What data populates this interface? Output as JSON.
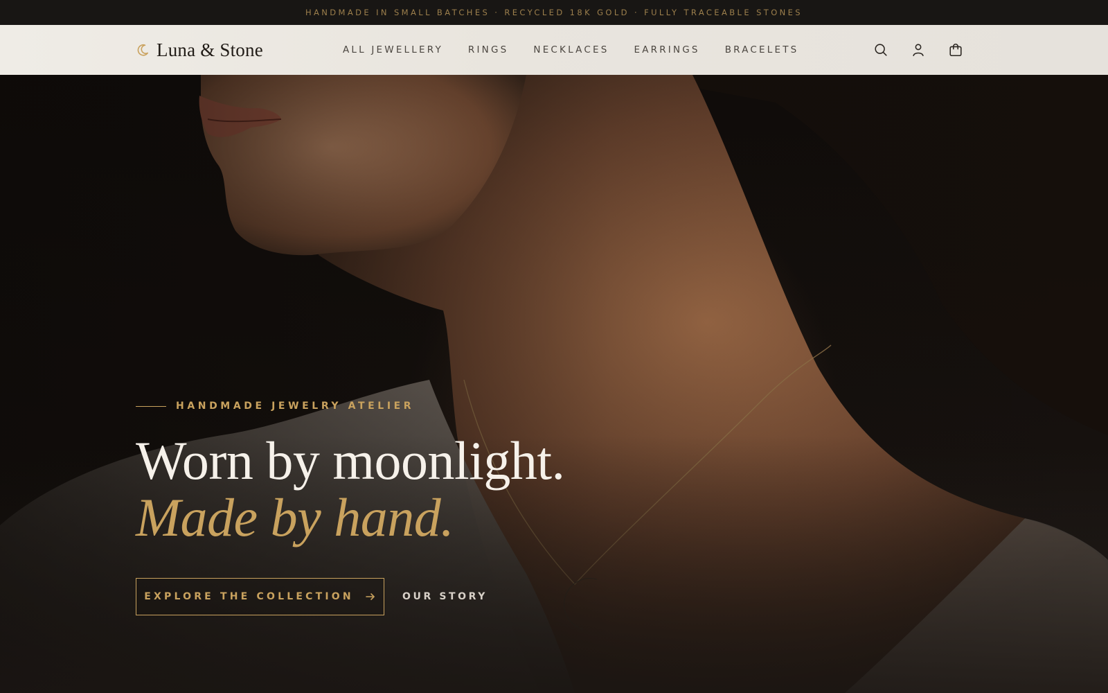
{
  "announcement": {
    "text": "HANDMADE IN SMALL BATCHES · RECYCLED 18K GOLD · FULLY TRACEABLE STONES"
  },
  "header": {
    "brand": "Luna & Stone",
    "logo_icon": "crescent-moon-icon",
    "nav": [
      {
        "label": "ALL JEWELLERY"
      },
      {
        "label": "RINGS"
      },
      {
        "label": "NECKLACES"
      },
      {
        "label": "EARRINGS"
      },
      {
        "label": "BRACELETS"
      }
    ],
    "actions": [
      {
        "icon": "search-icon"
      },
      {
        "icon": "account-icon"
      },
      {
        "icon": "bag-icon"
      }
    ]
  },
  "hero": {
    "eyebrow": "HANDMADE JEWELRY ATELIER",
    "headline": "Worn by moonlight.",
    "subheadline": "Made by hand.",
    "primary_cta": "EXPLORE THE COLLECTION",
    "primary_cta_icon": "arrow-right-icon",
    "secondary_cta": "OUR STORY",
    "image": "model-wearing-crescent-necklace"
  },
  "colors": {
    "gold": "#c9a25e",
    "topbar_bg": "#181614",
    "header_bg": "#ebe7e1",
    "hero_text": "#f6f1ea"
  }
}
